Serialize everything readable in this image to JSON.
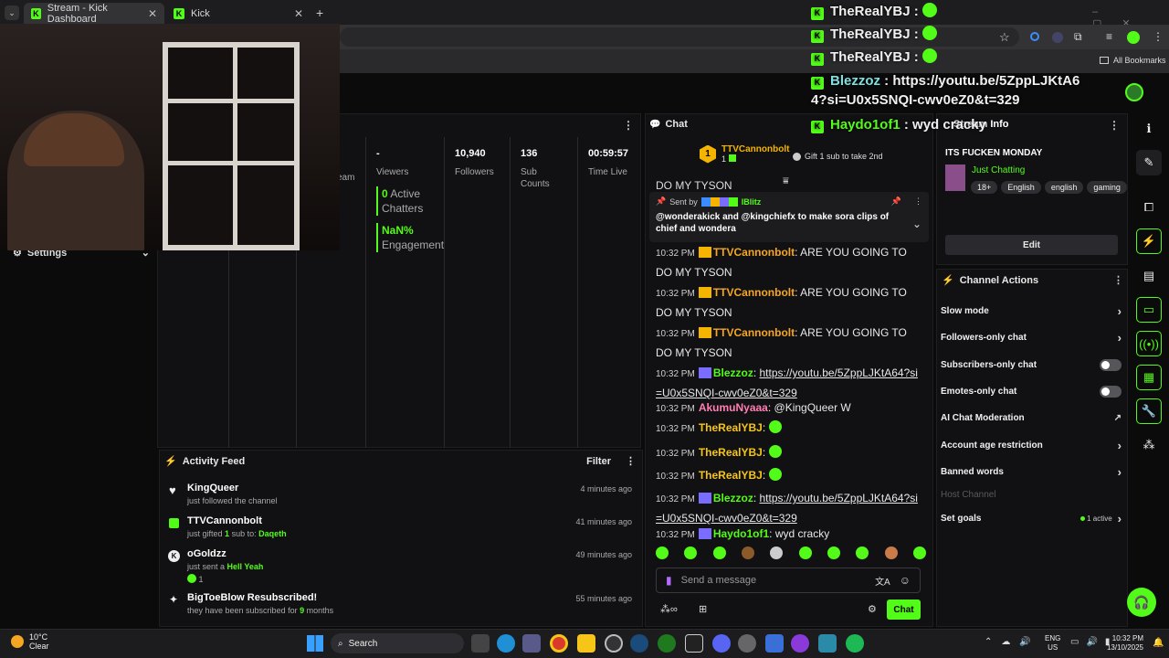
{
  "browser": {
    "tabs": [
      {
        "label": "Stream - Kick Dashboard"
      },
      {
        "label": "Kick"
      }
    ],
    "all_bookmarks": "All Bookmarks"
  },
  "overlay_chat": [
    {
      "user": "TheRealYBJ",
      "text": ""
    },
    {
      "user": "TheRealYBJ",
      "text": ""
    },
    {
      "user": "TheRealYBJ",
      "text": ""
    },
    {
      "user": "Blezzoz",
      "text": "https://youtu.be/5ZppLJKtA64?si=U0x5SNQI-cwv0eZ0&t=329"
    },
    {
      "user": "Haydo1of1",
      "text": "wyd cracky"
    }
  ],
  "left_nav": {
    "settings_label": "Settings"
  },
  "stats": [
    {
      "value": "",
      "label": "eam"
    },
    {
      "value": "-",
      "label": "Viewers"
    },
    {
      "value": "10,940",
      "label": "Followers"
    },
    {
      "value": "136",
      "label": "Sub Counts"
    },
    {
      "value": "00:59:57",
      "label": "Time Live"
    }
  ],
  "chatters": {
    "count": "0",
    "label": "Active Chatters"
  },
  "engagement": {
    "value": "NaN%",
    "label": "Engagement"
  },
  "activity": {
    "title": "Activity Feed",
    "filter_label": "Filter",
    "items": [
      {
        "name": "KingQueer",
        "sub": "just followed the channel",
        "time": "4 minutes ago",
        "icon": "heart-icon"
      },
      {
        "name": "TTVCannonbolt",
        "sub": "just gifted",
        "count": "1",
        "sub2": "sub to:",
        "target": "Daqeth",
        "time": "41 minutes ago",
        "icon": "gift-icon"
      },
      {
        "name": "oGoldzz",
        "sub": "just sent a",
        "target": "Hell Yeah",
        "count": "1",
        "time": "49 minutes ago",
        "icon": "kicks-icon"
      },
      {
        "name": "BigToeBlow Resubscribed!",
        "sub": "they have been subscribed for",
        "count": "9",
        "sub2": "months",
        "time": "55 minutes ago",
        "icon": "sparkle-icon"
      }
    ]
  },
  "chat": {
    "title": "Chat",
    "top_gifter": {
      "rank": "1",
      "name": "TTVCannonbolt",
      "count": "1"
    },
    "gift_prompt": "Gift 1 sub to take 2nd",
    "pinned": {
      "sent_by": "Sent by",
      "user": "IBlitz",
      "text": "@wonderakick and @kingchiefx to make sora clips of chief and wondera"
    },
    "cut_line": "DO MY TYSON",
    "messages": [
      {
        "time": "10:32 PM",
        "user": "TTVCannonbolt",
        "color": "#f5a623",
        "text": "ARE YOU GOING TO DO MY TYSON"
      },
      {
        "time": "10:32 PM",
        "user": "TTVCannonbolt",
        "color": "#f5a623",
        "text": "ARE YOU GOING TO DO MY TYSON"
      },
      {
        "time": "10:32 PM",
        "user": "TTVCannonbolt",
        "color": "#f5a623",
        "text": "ARE YOU GOING TO DO MY TYSON"
      },
      {
        "time": "10:32 PM",
        "user": "Blezzoz",
        "color": "#53fc18",
        "text": "https://youtu.be/5ZppLJKtA64?si=U0x5SNQI-cwv0eZ0&t=329"
      },
      {
        "time": "10:32 PM",
        "user": "AkumuNyaaa",
        "color": "#ff7eb3",
        "text": "@KingQueer W"
      },
      {
        "time": "10:32 PM",
        "user": "TheRealYBJ",
        "color": "#f5c518",
        "text": ""
      },
      {
        "time": "10:32 PM",
        "user": "TheRealYBJ",
        "color": "#f5c518",
        "text": ""
      },
      {
        "time": "10:32 PM",
        "user": "TheRealYBJ",
        "color": "#f5c518",
        "text": ""
      },
      {
        "time": "10:32 PM",
        "user": "Blezzoz",
        "color": "#53fc18",
        "text": "https://youtu.be/5ZppLJKtA64?si=U0x5SNQI-cwv0eZ0&t=329"
      },
      {
        "time": "10:32 PM",
        "user": "Haydo1of1",
        "color": "#53fc18",
        "text": "wyd cracky"
      }
    ],
    "input_placeholder": "Send a message",
    "send_label": "Chat"
  },
  "stream_info": {
    "title_partial": "Stream Info",
    "stream_title": "ITS FUCKEN MONDAY",
    "category": "Just Chatting",
    "tags": [
      "18+",
      "English",
      "english",
      "gaming"
    ],
    "edit_label": "Edit"
  },
  "channel_actions": {
    "title": "Channel Actions",
    "items": [
      {
        "label": "Slow mode",
        "control": "chevron"
      },
      {
        "label": "Followers-only chat",
        "control": "chevron"
      },
      {
        "label": "Subscribers-only chat",
        "control": "toggle"
      },
      {
        "label": "Emotes-only chat",
        "control": "toggle"
      },
      {
        "label": "AI Chat Moderation",
        "control": "external"
      },
      {
        "label": "Account age restriction",
        "control": "chevron"
      },
      {
        "label": "Banned words",
        "control": "chevron"
      },
      {
        "label": "Host Channel",
        "control": "none"
      },
      {
        "label": "Set goals",
        "control": "chevron",
        "status": "1 active"
      }
    ]
  },
  "taskbar": {
    "weather_temp": "10°C",
    "weather_desc": "Clear",
    "search_label": "Search",
    "lang1": "ENG",
    "lang2": "US",
    "time": "10:32 PM",
    "date": "13/10/2025"
  },
  "colors": {
    "accent": "#53fc18",
    "panel": "#111113",
    "bg": "#0b0b0c"
  }
}
